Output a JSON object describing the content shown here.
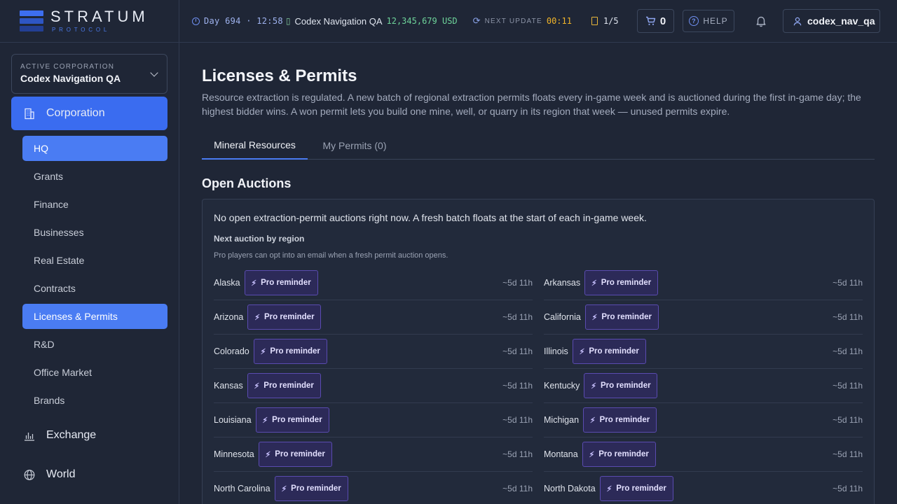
{
  "brand": {
    "name": "STRATUM",
    "sub": "PROTOCOL"
  },
  "status": {
    "day": "Day 694 · 12:58",
    "corp": "Codex Navigation QA",
    "money": "12,345,679 USD",
    "next_label": "NEXT UPDATE",
    "next_time": "00:11",
    "docs": "1/5"
  },
  "toolbar": {
    "cart_count": "0",
    "help_label": "HELP",
    "username": "codex_nav_qa"
  },
  "sidebar": {
    "corp_label": "ACTIVE CORPORATION",
    "corp_name": "Codex Navigation QA",
    "main_items": [
      {
        "label": "Corporation",
        "icon": "building-icon"
      },
      {
        "label": "Exchange",
        "icon": "chart-icon"
      },
      {
        "label": "World",
        "icon": "globe-icon"
      }
    ],
    "sub_items": [
      "HQ",
      "Grants",
      "Finance",
      "Businesses",
      "Real Estate",
      "Contracts",
      "Licenses & Permits",
      "R&D",
      "Office Market",
      "Brands"
    ]
  },
  "page": {
    "title": "Licenses & Permits",
    "description": "Resource extraction is regulated. A new batch of regional extraction permits floats every in-game week and is auctioned during the first in-game day; the highest bidder wins. A won permit lets you build one mine, well, or quarry in its region that week — unused permits expire.",
    "tabs": [
      "Mineral Resources",
      "My Permits (0)"
    ],
    "section_title": "Open Auctions",
    "note": "No open extraction-permit auctions right now. A fresh batch floats at the start of each in-game week.",
    "subheading": "Next auction by region",
    "hint": "Pro players can opt into an email when a fresh permit auction opens.",
    "reminder_label": "Pro reminder",
    "regions": [
      {
        "name": "Alaska",
        "time": "~5d 11h"
      },
      {
        "name": "Arkansas",
        "time": "~5d 11h"
      },
      {
        "name": "Arizona",
        "time": "~5d 11h"
      },
      {
        "name": "California",
        "time": "~5d 11h"
      },
      {
        "name": "Colorado",
        "time": "~5d 11h"
      },
      {
        "name": "Illinois",
        "time": "~5d 11h"
      },
      {
        "name": "Kansas",
        "time": "~5d 11h"
      },
      {
        "name": "Kentucky",
        "time": "~5d 11h"
      },
      {
        "name": "Louisiana",
        "time": "~5d 11h"
      },
      {
        "name": "Michigan",
        "time": "~5d 11h"
      },
      {
        "name": "Minnesota",
        "time": "~5d 11h"
      },
      {
        "name": "Montana",
        "time": "~5d 11h"
      },
      {
        "name": "North Carolina",
        "time": "~5d 11h"
      },
      {
        "name": "North Dakota",
        "time": "~5d 11h"
      }
    ]
  }
}
